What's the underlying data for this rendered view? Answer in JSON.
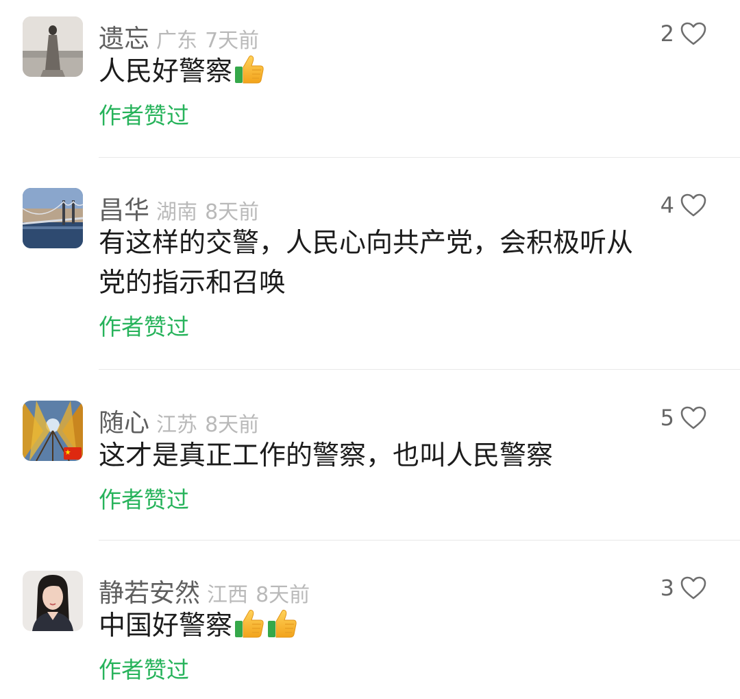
{
  "comments": [
    {
      "name": "遗忘",
      "location": "广东",
      "time": "7天前",
      "likes": "2",
      "text": "人民好警察",
      "emojis": [
        "thumbs-up"
      ],
      "author_liked": "作者赞过",
      "avatar": "woman-by-sea-avatar"
    },
    {
      "name": "昌华",
      "location": "湖南",
      "time": "8天前",
      "likes": "4",
      "text_line1": "有这样的交警，人民心向共产党，会积极听从",
      "text_line2": "党的指示和召唤",
      "author_liked": "作者赞过",
      "avatar": "bridge-avatar"
    },
    {
      "name": "随心",
      "location": "江苏",
      "time": "8天前",
      "likes": "5",
      "text": "这才是真正工作的警察，也叫人民警察",
      "author_liked": "作者赞过",
      "avatar": "autumn-trees-avatar"
    },
    {
      "name": "静若安然",
      "location": "江西",
      "time": "8天前",
      "likes": "3",
      "text": "中国好警察",
      "emojis": [
        "thumbs-up",
        "thumbs-up"
      ],
      "author_liked": "作者赞过",
      "avatar": "woman-portrait-avatar"
    }
  ],
  "colors": {
    "author_liked": "#27b35b",
    "name": "#5f5f5f",
    "meta": "#b9b9b9",
    "text": "#1c1c1c",
    "divider": "#e8e8e8"
  }
}
